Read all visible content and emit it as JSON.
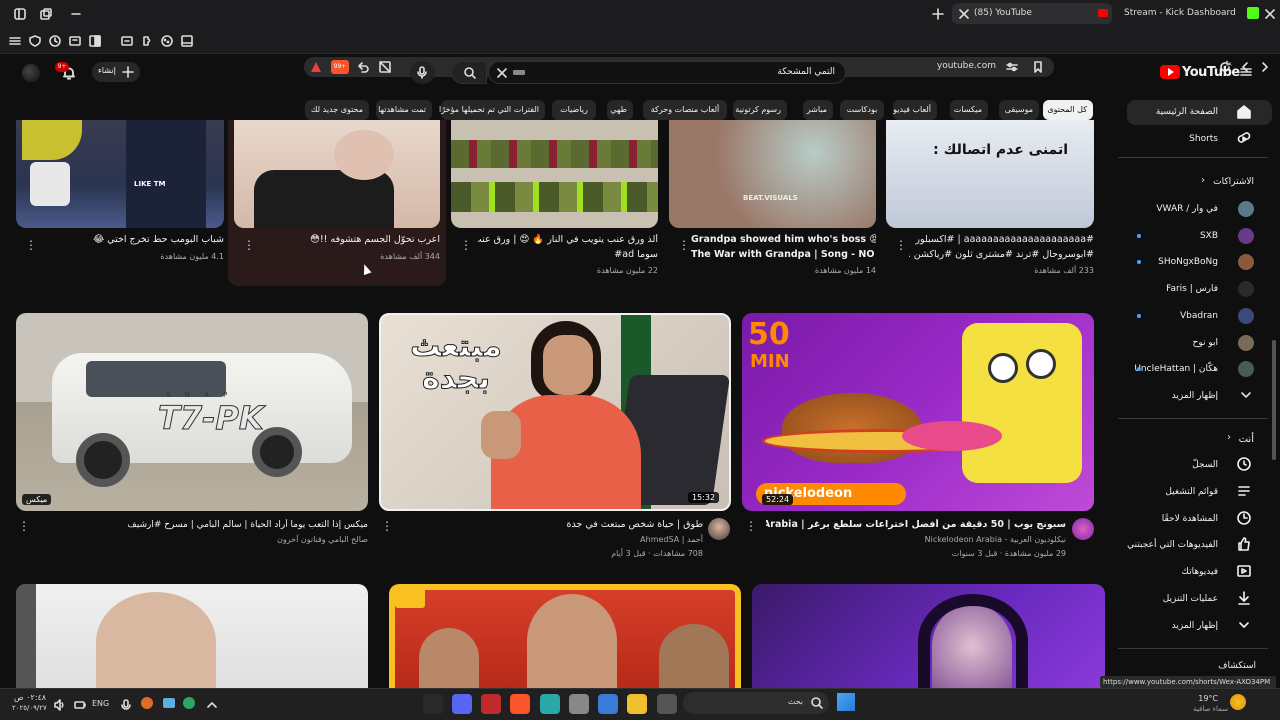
{
  "browser": {
    "tabs": [
      {
        "label": "(85) YouTube",
        "active": true
      },
      {
        "label": "Stream - Kick Dashboard",
        "active": false
      }
    ],
    "address": "youtube.com",
    "shield_count": "99+"
  },
  "header": {
    "logo_text": "YouTube",
    "logo_region": "SA",
    "search_value": "التمي المشحكة",
    "create_label": "إنشاء",
    "notifications_badge": "9+"
  },
  "chips": [
    "كل المحتوى",
    "موسيقى",
    "ميكسات",
    "ألعاب فيديو",
    "بودكاست",
    "مباشر",
    "رسوم كرتونية",
    "ألعاب منصات وحركة",
    "طهي",
    "رياضيات",
    "الفترات التي تم تحميلها مؤخرًا",
    "تمت مشاهدتها",
    "محتوى جديد لك"
  ],
  "sidebar": {
    "home": "الصفحة الرئيسية",
    "shorts": "Shorts",
    "subscriptions_header": "الاشتراكات",
    "subscriptions": [
      {
        "name": "في وار / VWAR",
        "dot": false,
        "color": "#5a7a8a"
      },
      {
        "name": "SXB",
        "dot": true,
        "color": "#6a3a8a"
      },
      {
        "name": "SHoNgxBoNg",
        "dot": true,
        "color": "#8a5a3a"
      },
      {
        "name": "فارس | Faris",
        "dot": false,
        "color": "#2a2a2a"
      },
      {
        "name": "Vbadran",
        "dot": true,
        "color": "#3a4a7a"
      },
      {
        "name": "ابو نوح",
        "dot": false,
        "color": "#7a6a5a"
      },
      {
        "name": "هكّان | UncleHattan",
        "dot": true,
        "color": "#4a5a5a"
      }
    ],
    "show_more": "إظهار المزيد",
    "you_header": "أنت",
    "you_items": [
      "السجلّ",
      "قوائم التشغيل",
      "المشاهدة لاحقًا",
      "الفيديوهات التي أعجبتني",
      "فيديوهاتك",
      "عمليات التنزيل",
      "إظهار المزيد"
    ],
    "explore": "استكشاف"
  },
  "row1": [
    {
      "title": "شباب البومب حط تخرج اختي 😂",
      "meta": "4.1 مليون مشاهدة"
    },
    {
      "title": "اعرب تحوّل الجسم هتشوفه !!😳",
      "meta": "344 ألف مشاهدة"
    },
    {
      "title": "ألذ ورق عنب يتويب في النار 🔥 😍 | ورق عنب",
      "title2": "سوما ad#",
      "meta": "22 مليون مشاهدة"
    },
    {
      "title": "Grandpa showed him who's boss 😡 \"\"",
      "title2": "The War with Grandpa | Song - NO | ...",
      "meta": "14 مليون مشاهدة"
    },
    {
      "title": "#aaaaaaaaaaaaaaaaaaaaa | #اكسبلور",
      "title2": "#ابوسروحال #ترند #مشترى ثلون #رياكشن ...",
      "meta": "233 ألف مشاهدة",
      "thumb_text": "اتمنى عدم اتصالك :"
    }
  ],
  "row1_thumb_texts": {
    "like": "LIKE TM",
    "beat": "BEAT.VISUALS"
  },
  "row2": [
    {
      "title": "ميكس إذا التعب يوما أراد الحياة | سالم البامي | مسرح #ارشيف",
      "channel": "صالح البامي وفنانون آخرون",
      "meta": "",
      "duration": "ميكس",
      "plate": "T7-PK",
      "plate_small": "S N A P"
    },
    {
      "title": "طوق | حياة شخص مبتعث في جدة",
      "channel": "أحمد | AhmedSA",
      "meta": "708 مشاهدات · قبل 3 أيام",
      "duration": "15:32",
      "thumb_text": "مبتعث بجدة"
    },
    {
      "title": "سبونج بوب | 50 دقيقة من أفضل اختراعات سلطع برغر | Nickelodeon Arabia",
      "channel": "نيكلوديون العربية - Nickelodeon Arabia",
      "meta": "29 مليون مشاهدة · قبل 3 سنوات",
      "duration": "52:24",
      "big": "50",
      "big2": "MIN",
      "brand": "nickelodeon"
    }
  ],
  "status_url": "https://www.youtube.com/shorts/Wex-AXO34PM",
  "taskbar": {
    "search": "بحث",
    "lang": "ENG",
    "time": "٠٢:٤٨ ص",
    "date": "٢٠٢٥/٠٩/٢٧",
    "weather_temp": "19°C",
    "weather_desc": "سماء صافية"
  },
  "colors": {
    "accent": "#ff0000",
    "link": "#3ea6ff",
    "bg": "#0f0f0f"
  }
}
